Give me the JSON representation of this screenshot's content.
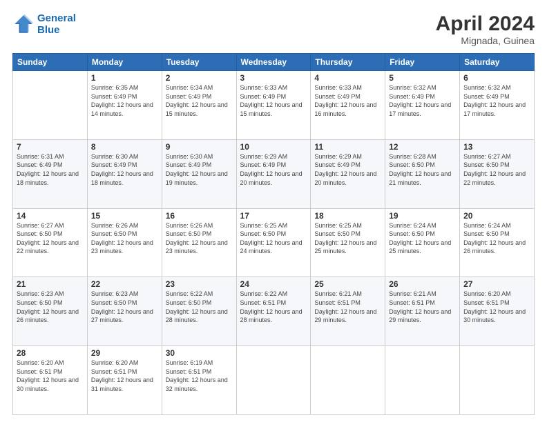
{
  "logo": {
    "line1": "General",
    "line2": "Blue"
  },
  "header": {
    "month": "April 2024",
    "location": "Mignada, Guinea"
  },
  "weekdays": [
    "Sunday",
    "Monday",
    "Tuesday",
    "Wednesday",
    "Thursday",
    "Friday",
    "Saturday"
  ],
  "weeks": [
    [
      {
        "day": "",
        "sunrise": "",
        "sunset": "",
        "daylight": ""
      },
      {
        "day": "1",
        "sunrise": "Sunrise: 6:35 AM",
        "sunset": "Sunset: 6:49 PM",
        "daylight": "Daylight: 12 hours and 14 minutes."
      },
      {
        "day": "2",
        "sunrise": "Sunrise: 6:34 AM",
        "sunset": "Sunset: 6:49 PM",
        "daylight": "Daylight: 12 hours and 15 minutes."
      },
      {
        "day": "3",
        "sunrise": "Sunrise: 6:33 AM",
        "sunset": "Sunset: 6:49 PM",
        "daylight": "Daylight: 12 hours and 15 minutes."
      },
      {
        "day": "4",
        "sunrise": "Sunrise: 6:33 AM",
        "sunset": "Sunset: 6:49 PM",
        "daylight": "Daylight: 12 hours and 16 minutes."
      },
      {
        "day": "5",
        "sunrise": "Sunrise: 6:32 AM",
        "sunset": "Sunset: 6:49 PM",
        "daylight": "Daylight: 12 hours and 17 minutes."
      },
      {
        "day": "6",
        "sunrise": "Sunrise: 6:32 AM",
        "sunset": "Sunset: 6:49 PM",
        "daylight": "Daylight: 12 hours and 17 minutes."
      }
    ],
    [
      {
        "day": "7",
        "sunrise": "Sunrise: 6:31 AM",
        "sunset": "Sunset: 6:49 PM",
        "daylight": "Daylight: 12 hours and 18 minutes."
      },
      {
        "day": "8",
        "sunrise": "Sunrise: 6:30 AM",
        "sunset": "Sunset: 6:49 PM",
        "daylight": "Daylight: 12 hours and 18 minutes."
      },
      {
        "day": "9",
        "sunrise": "Sunrise: 6:30 AM",
        "sunset": "Sunset: 6:49 PM",
        "daylight": "Daylight: 12 hours and 19 minutes."
      },
      {
        "day": "10",
        "sunrise": "Sunrise: 6:29 AM",
        "sunset": "Sunset: 6:49 PM",
        "daylight": "Daylight: 12 hours and 20 minutes."
      },
      {
        "day": "11",
        "sunrise": "Sunrise: 6:29 AM",
        "sunset": "Sunset: 6:49 PM",
        "daylight": "Daylight: 12 hours and 20 minutes."
      },
      {
        "day": "12",
        "sunrise": "Sunrise: 6:28 AM",
        "sunset": "Sunset: 6:50 PM",
        "daylight": "Daylight: 12 hours and 21 minutes."
      },
      {
        "day": "13",
        "sunrise": "Sunrise: 6:27 AM",
        "sunset": "Sunset: 6:50 PM",
        "daylight": "Daylight: 12 hours and 22 minutes."
      }
    ],
    [
      {
        "day": "14",
        "sunrise": "Sunrise: 6:27 AM",
        "sunset": "Sunset: 6:50 PM",
        "daylight": "Daylight: 12 hours and 22 minutes."
      },
      {
        "day": "15",
        "sunrise": "Sunrise: 6:26 AM",
        "sunset": "Sunset: 6:50 PM",
        "daylight": "Daylight: 12 hours and 23 minutes."
      },
      {
        "day": "16",
        "sunrise": "Sunrise: 6:26 AM",
        "sunset": "Sunset: 6:50 PM",
        "daylight": "Daylight: 12 hours and 23 minutes."
      },
      {
        "day": "17",
        "sunrise": "Sunrise: 6:25 AM",
        "sunset": "Sunset: 6:50 PM",
        "daylight": "Daylight: 12 hours and 24 minutes."
      },
      {
        "day": "18",
        "sunrise": "Sunrise: 6:25 AM",
        "sunset": "Sunset: 6:50 PM",
        "daylight": "Daylight: 12 hours and 25 minutes."
      },
      {
        "day": "19",
        "sunrise": "Sunrise: 6:24 AM",
        "sunset": "Sunset: 6:50 PM",
        "daylight": "Daylight: 12 hours and 25 minutes."
      },
      {
        "day": "20",
        "sunrise": "Sunrise: 6:24 AM",
        "sunset": "Sunset: 6:50 PM",
        "daylight": "Daylight: 12 hours and 26 minutes."
      }
    ],
    [
      {
        "day": "21",
        "sunrise": "Sunrise: 6:23 AM",
        "sunset": "Sunset: 6:50 PM",
        "daylight": "Daylight: 12 hours and 26 minutes."
      },
      {
        "day": "22",
        "sunrise": "Sunrise: 6:23 AM",
        "sunset": "Sunset: 6:50 PM",
        "daylight": "Daylight: 12 hours and 27 minutes."
      },
      {
        "day": "23",
        "sunrise": "Sunrise: 6:22 AM",
        "sunset": "Sunset: 6:50 PM",
        "daylight": "Daylight: 12 hours and 28 minutes."
      },
      {
        "day": "24",
        "sunrise": "Sunrise: 6:22 AM",
        "sunset": "Sunset: 6:51 PM",
        "daylight": "Daylight: 12 hours and 28 minutes."
      },
      {
        "day": "25",
        "sunrise": "Sunrise: 6:21 AM",
        "sunset": "Sunset: 6:51 PM",
        "daylight": "Daylight: 12 hours and 29 minutes."
      },
      {
        "day": "26",
        "sunrise": "Sunrise: 6:21 AM",
        "sunset": "Sunset: 6:51 PM",
        "daylight": "Daylight: 12 hours and 29 minutes."
      },
      {
        "day": "27",
        "sunrise": "Sunrise: 6:20 AM",
        "sunset": "Sunset: 6:51 PM",
        "daylight": "Daylight: 12 hours and 30 minutes."
      }
    ],
    [
      {
        "day": "28",
        "sunrise": "Sunrise: 6:20 AM",
        "sunset": "Sunset: 6:51 PM",
        "daylight": "Daylight: 12 hours and 30 minutes."
      },
      {
        "day": "29",
        "sunrise": "Sunrise: 6:20 AM",
        "sunset": "Sunset: 6:51 PM",
        "daylight": "Daylight: 12 hours and 31 minutes."
      },
      {
        "day": "30",
        "sunrise": "Sunrise: 6:19 AM",
        "sunset": "Sunset: 6:51 PM",
        "daylight": "Daylight: 12 hours and 32 minutes."
      },
      {
        "day": "",
        "sunrise": "",
        "sunset": "",
        "daylight": ""
      },
      {
        "day": "",
        "sunrise": "",
        "sunset": "",
        "daylight": ""
      },
      {
        "day": "",
        "sunrise": "",
        "sunset": "",
        "daylight": ""
      },
      {
        "day": "",
        "sunrise": "",
        "sunset": "",
        "daylight": ""
      }
    ]
  ]
}
